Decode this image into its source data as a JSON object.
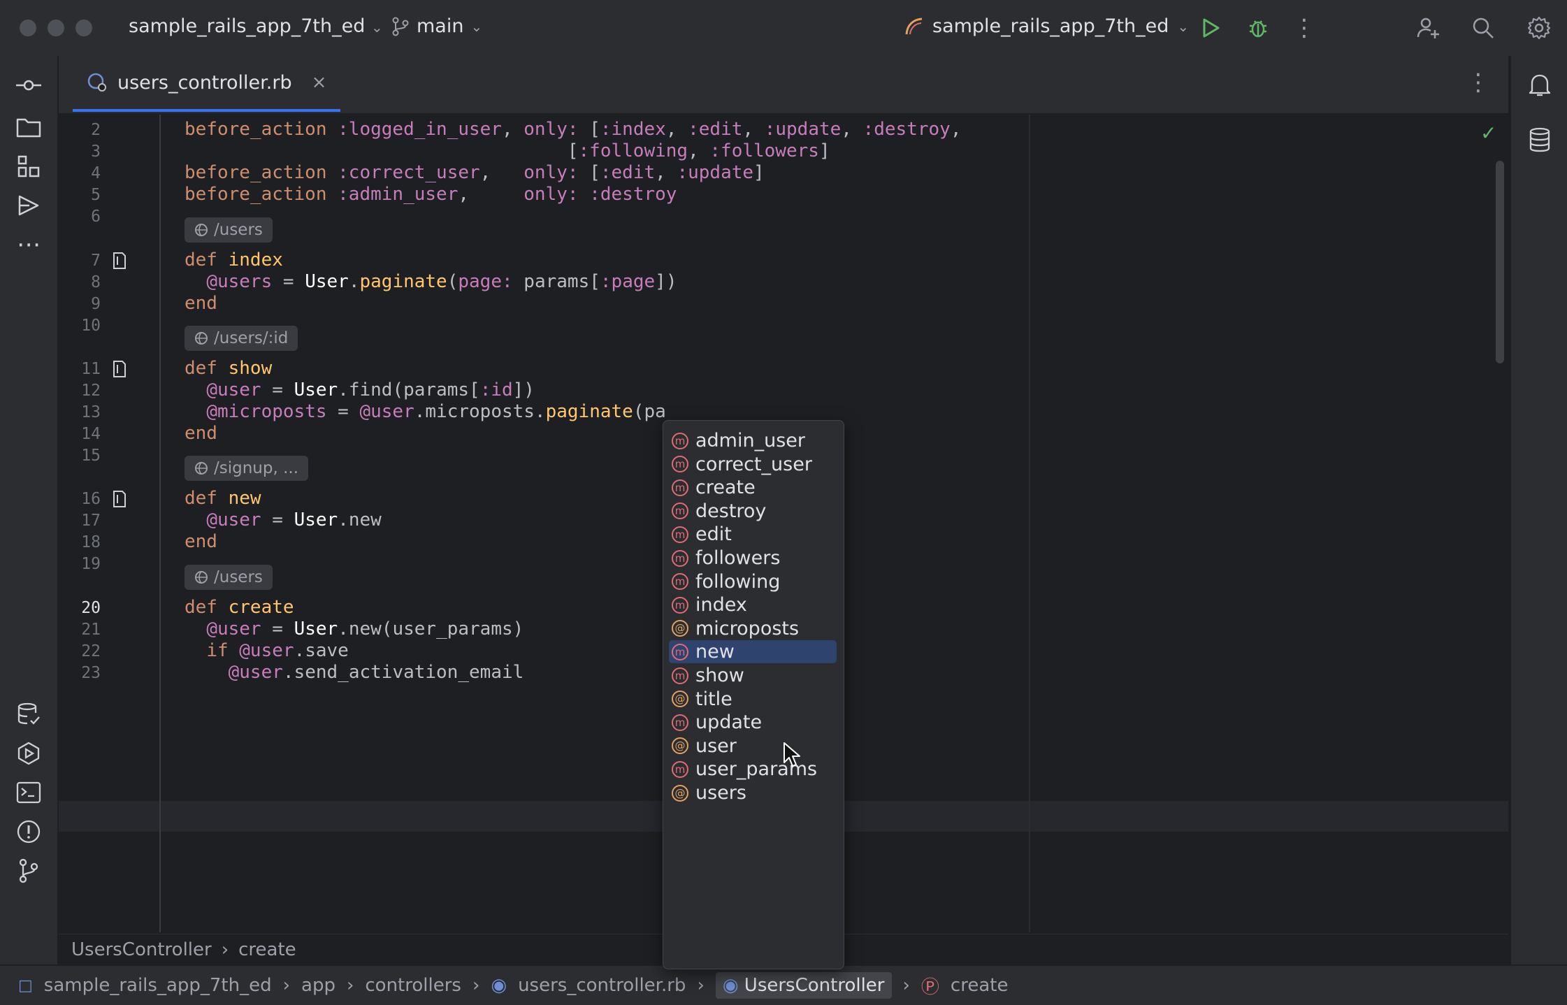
{
  "titlebar": {
    "project": "sample_rails_app_7th_ed",
    "branch": "main",
    "run_config": "sample_rails_app_7th_ed"
  },
  "tab": {
    "filename": "users_controller.rb",
    "close": "×"
  },
  "lines": [
    {
      "n": "2",
      "tokens": [
        [
          "kw",
          "before_action"
        ],
        [
          "plain",
          " "
        ],
        [
          "sym",
          ":logged_in_user"
        ],
        [
          "plain",
          ", "
        ],
        [
          "sym",
          "only:"
        ],
        [
          "plain",
          " ["
        ],
        [
          "sym",
          ":index"
        ],
        [
          "plain",
          ", "
        ],
        [
          "sym",
          ":edit"
        ],
        [
          "plain",
          ", "
        ],
        [
          "sym",
          ":update"
        ],
        [
          "plain",
          ", "
        ],
        [
          "sym",
          ":destroy"
        ],
        [
          "plain",
          ","
        ]
      ]
    },
    {
      "n": "3",
      "tokens": [
        [
          "plain",
          "                                   ["
        ],
        [
          "sym",
          ":following"
        ],
        [
          "plain",
          ", "
        ],
        [
          "sym",
          ":followers"
        ],
        [
          "plain",
          "]"
        ]
      ]
    },
    {
      "n": "4",
      "tokens": [
        [
          "kw",
          "before_action"
        ],
        [
          "plain",
          " "
        ],
        [
          "sym",
          ":correct_user"
        ],
        [
          "plain",
          ",   "
        ],
        [
          "sym",
          "only:"
        ],
        [
          "plain",
          " ["
        ],
        [
          "sym",
          ":edit"
        ],
        [
          "plain",
          ", "
        ],
        [
          "sym",
          ":update"
        ],
        [
          "plain",
          "]"
        ]
      ]
    },
    {
      "n": "5",
      "tokens": [
        [
          "kw",
          "before_action"
        ],
        [
          "plain",
          " "
        ],
        [
          "sym",
          ":admin_user"
        ],
        [
          "plain",
          ",     "
        ],
        [
          "sym",
          "only:"
        ],
        [
          "plain",
          " "
        ],
        [
          "sym",
          ":destroy"
        ]
      ]
    },
    {
      "n": "6",
      "tokens": []
    },
    {
      "n": "7",
      "tokens": [
        [
          "kw",
          "def"
        ],
        [
          "plain",
          " "
        ],
        [
          "fn",
          "index"
        ]
      ]
    },
    {
      "n": "8",
      "tokens": [
        [
          "plain",
          "  "
        ],
        [
          "ivar",
          "@users"
        ],
        [
          "plain",
          " = "
        ],
        [
          "cls",
          "User"
        ],
        [
          "plain",
          "."
        ],
        [
          "fn",
          "paginate"
        ],
        [
          "plain",
          "("
        ],
        [
          "sym",
          "page:"
        ],
        [
          "plain",
          " params["
        ],
        [
          "sym",
          ":page"
        ],
        [
          "plain",
          "])"
        ]
      ]
    },
    {
      "n": "9",
      "tokens": [
        [
          "kw",
          "end"
        ]
      ]
    },
    {
      "n": "10",
      "tokens": []
    },
    {
      "n": "11",
      "tokens": [
        [
          "kw",
          "def"
        ],
        [
          "plain",
          " "
        ],
        [
          "fn",
          "show"
        ]
      ]
    },
    {
      "n": "12",
      "tokens": [
        [
          "plain",
          "  "
        ],
        [
          "ivar",
          "@user"
        ],
        [
          "plain",
          " = "
        ],
        [
          "cls",
          "User"
        ],
        [
          "plain",
          ".find(params["
        ],
        [
          "sym",
          ":id"
        ],
        [
          "plain",
          "])"
        ]
      ]
    },
    {
      "n": "13",
      "tokens": [
        [
          "plain",
          "  "
        ],
        [
          "ivar",
          "@microposts"
        ],
        [
          "plain",
          " = "
        ],
        [
          "ivar",
          "@user"
        ],
        [
          "plain",
          ".microposts."
        ],
        [
          "fn",
          "paginate"
        ],
        [
          "plain",
          "(pa"
        ]
      ]
    },
    {
      "n": "14",
      "tokens": [
        [
          "kw",
          "end"
        ]
      ]
    },
    {
      "n": "15",
      "tokens": []
    },
    {
      "n": "16",
      "tokens": [
        [
          "kw",
          "def"
        ],
        [
          "plain",
          " "
        ],
        [
          "fn",
          "new"
        ]
      ]
    },
    {
      "n": "17",
      "tokens": [
        [
          "plain",
          "  "
        ],
        [
          "ivar",
          "@user"
        ],
        [
          "plain",
          " = "
        ],
        [
          "cls",
          "User"
        ],
        [
          "plain",
          ".new"
        ]
      ]
    },
    {
      "n": "18",
      "tokens": [
        [
          "kw",
          "end"
        ]
      ]
    },
    {
      "n": "19",
      "tokens": []
    },
    {
      "n": "20",
      "tokens": [
        [
          "kw",
          "def"
        ],
        [
          "plain",
          " "
        ],
        [
          "fn",
          "create"
        ]
      ]
    },
    {
      "n": "21",
      "tokens": [
        [
          "plain",
          "  "
        ],
        [
          "ivar",
          "@user"
        ],
        [
          "plain",
          " = "
        ],
        [
          "cls",
          "User"
        ],
        [
          "plain",
          ".new(user_params)"
        ]
      ]
    },
    {
      "n": "22",
      "tokens": [
        [
          "plain",
          "  "
        ],
        [
          "kw",
          "if"
        ],
        [
          "plain",
          " "
        ],
        [
          "ivar",
          "@user"
        ],
        [
          "plain",
          ".save"
        ]
      ]
    },
    {
      "n": "23",
      "tokens": [
        [
          "plain",
          "    "
        ],
        [
          "ivar",
          "@user"
        ],
        [
          "plain",
          ".send_activation_email"
        ]
      ]
    }
  ],
  "routes": [
    "/users",
    "/users/:id",
    "/signup, ...",
    "/users"
  ],
  "completion": [
    {
      "label": "admin_user",
      "kind": "m"
    },
    {
      "label": "correct_user",
      "kind": "m"
    },
    {
      "label": "create",
      "kind": "m"
    },
    {
      "label": "destroy",
      "kind": "m"
    },
    {
      "label": "edit",
      "kind": "m"
    },
    {
      "label": "followers",
      "kind": "m"
    },
    {
      "label": "following",
      "kind": "m"
    },
    {
      "label": "index",
      "kind": "m"
    },
    {
      "label": "microposts",
      "kind": "@"
    },
    {
      "label": "new",
      "kind": "m",
      "selected": true
    },
    {
      "label": "show",
      "kind": "m"
    },
    {
      "label": "title",
      "kind": "@"
    },
    {
      "label": "update",
      "kind": "m"
    },
    {
      "label": "user",
      "kind": "@"
    },
    {
      "label": "user_params",
      "kind": "m"
    },
    {
      "label": "users",
      "kind": "@"
    }
  ],
  "breadcrumb": {
    "cls": "UsersController",
    "method": "create"
  },
  "statusbar": {
    "project": "sample_rails_app_7th_ed",
    "app": "app",
    "controllers": "controllers",
    "file": "users_controller.rb",
    "cls": "UsersController",
    "method": "create"
  }
}
